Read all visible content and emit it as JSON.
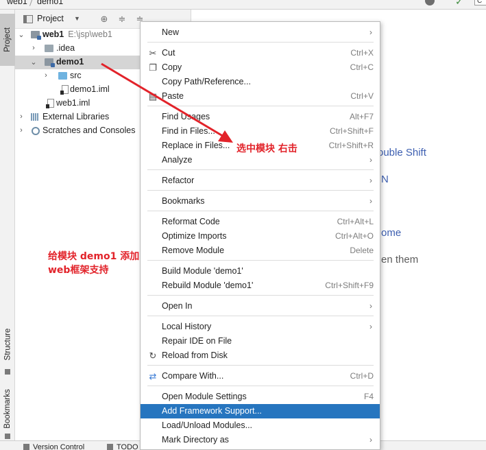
{
  "breadcrumb": {
    "project": "web1",
    "module": "demo1"
  },
  "tool_stripe": {
    "project": "Project",
    "structure": "Structure",
    "bookmarks": "Bookmarks"
  },
  "panel": {
    "title": "Project"
  },
  "tree": [
    {
      "label": "web1",
      "path": "E:\\jsp\\web1",
      "arrow": "⌄"
    },
    {
      "label": ".idea",
      "arrow": "›"
    },
    {
      "label": "demo1",
      "arrow": "⌄"
    },
    {
      "label": "src",
      "arrow": "›"
    },
    {
      "label": "demo1.iml"
    },
    {
      "label": "web1.iml"
    },
    {
      "label": "External Libraries",
      "arrow": "›"
    },
    {
      "label": "Scratches and Consoles",
      "arrow": "›"
    }
  ],
  "editor_hints": [
    "ouble Shift",
    "N",
    "ome",
    "en them"
  ],
  "bottom_tabs": {
    "vc": "Version Control",
    "todo": "TODO"
  },
  "menu": [
    {
      "label": "New",
      "shortcut": "",
      "submenu": true
    },
    {
      "label": "Cut",
      "shortcut": "Ctrl+X",
      "icon": "cut-icon"
    },
    {
      "label": "Copy",
      "shortcut": "Ctrl+C",
      "icon": "copy-icon"
    },
    {
      "label": "Copy Path/Reference...",
      "shortcut": ""
    },
    {
      "label": "Paste",
      "shortcut": "Ctrl+V",
      "icon": "paste-icon"
    },
    {
      "label": "Find Usages",
      "shortcut": "Alt+F7"
    },
    {
      "label": "Find in Files...",
      "shortcut": "Ctrl+Shift+F"
    },
    {
      "label": "Replace in Files...",
      "shortcut": "Ctrl+Shift+R"
    },
    {
      "label": "Analyze",
      "shortcut": "",
      "submenu": true
    },
    {
      "label": "Refactor",
      "shortcut": "",
      "submenu": true
    },
    {
      "label": "Bookmarks",
      "shortcut": "",
      "submenu": true
    },
    {
      "label": "Reformat Code",
      "shortcut": "Ctrl+Alt+L"
    },
    {
      "label": "Optimize Imports",
      "shortcut": "Ctrl+Alt+O"
    },
    {
      "label": "Remove Module",
      "shortcut": "Delete"
    },
    {
      "label": "Build Module 'demo1'",
      "shortcut": ""
    },
    {
      "label": "Rebuild Module 'demo1'",
      "shortcut": "Ctrl+Shift+F9"
    },
    {
      "label": "Open In",
      "shortcut": "",
      "submenu": true
    },
    {
      "label": "Local History",
      "shortcut": "",
      "submenu": true
    },
    {
      "label": "Repair IDE on File",
      "shortcut": ""
    },
    {
      "label": "Reload from Disk",
      "shortcut": "",
      "icon": "reload-icon"
    },
    {
      "label": "Compare With...",
      "shortcut": "Ctrl+D",
      "icon": "compare-icon"
    },
    {
      "label": "Open Module Settings",
      "shortcut": "F4"
    },
    {
      "label": "Add Framework Support...",
      "shortcut": "",
      "highlighted": true
    },
    {
      "label": "Load/Unload Modules...",
      "shortcut": ""
    },
    {
      "label": "Mark Directory as",
      "shortcut": "",
      "submenu": true
    }
  ],
  "annotations": {
    "select_right_click": "选中模块   右击",
    "add_web_line1": "给模块  demo1  添加",
    "add_web_line2": "web框架支持"
  },
  "colors": {
    "highlight": "#2675bf",
    "annotation": "#e2232a",
    "hint_link": "#3c5eb0"
  }
}
